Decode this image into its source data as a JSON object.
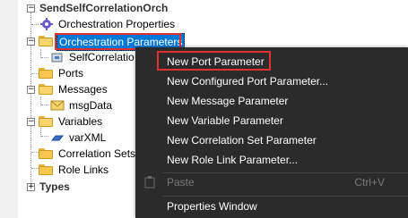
{
  "tree": {
    "root_label": "SendSelfCorrelationOrch",
    "items": [
      {
        "label": "Orchestration Properties"
      },
      {
        "label": "Orchestration Parameters"
      },
      {
        "label": "SelfCorrelatio"
      },
      {
        "label": "Ports"
      },
      {
        "label": "Messages"
      },
      {
        "label": "msgData"
      },
      {
        "label": "Variables"
      },
      {
        "label": "varXML"
      },
      {
        "label": "Correlation Sets"
      },
      {
        "label": "Role Links"
      },
      {
        "label": "Types"
      }
    ],
    "selected_item": "Orchestration Parameters"
  },
  "context_menu": {
    "items": [
      {
        "label": "New Port Parameter",
        "highlighted": true
      },
      {
        "label": "New Configured Port Parameter..."
      },
      {
        "label": "New Message Parameter"
      },
      {
        "label": "New Variable Parameter"
      },
      {
        "label": "New Correlation Set Parameter"
      },
      {
        "label": "New Role Link Parameter..."
      },
      {
        "label": "Paste",
        "shortcut": "Ctrl+V",
        "disabled": true
      },
      {
        "label": "Properties Window"
      }
    ]
  },
  "colors": {
    "selection": "#0078d7",
    "highlight_border": "#e03030",
    "menu_background": "#2b2b2b"
  }
}
